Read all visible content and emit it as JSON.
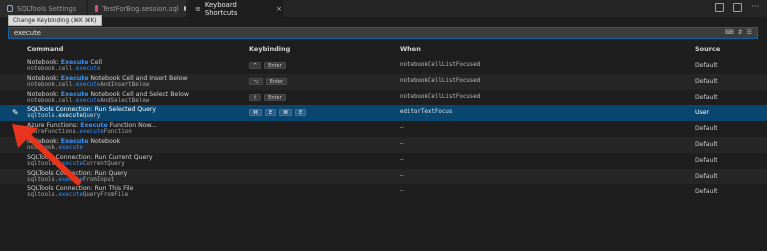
{
  "tabs": [
    {
      "label": "SQLTools Settings",
      "active": false
    },
    {
      "label": "TestForBog.session.sql",
      "active": false,
      "modified": true
    },
    {
      "label": "Keyboard Shortcuts",
      "active": true,
      "close": "×"
    }
  ],
  "tooltip": "Change Keybinding (⌘K ⌘K)",
  "search": {
    "value": "execute",
    "icons": [
      "⌨",
      "⇵",
      "☰"
    ]
  },
  "headers": {
    "command": "Command",
    "keybinding": "Keybinding",
    "when": "When",
    "source": "Source"
  },
  "rows": [
    {
      "title_pre": "Notebook: ",
      "title_hl": "Execute",
      "title_post": " Cell",
      "id_pre": "notebook.cell.",
      "id_hl": "execute",
      "id_post": "",
      "keys": [
        "^",
        "Enter"
      ],
      "when": "notebookCellListFocused",
      "source": "Default"
    },
    {
      "title_pre": "Notebook: ",
      "title_hl": "Execute",
      "title_post": " Notebook Cell and Insert Below",
      "id_pre": "notebook.cell.",
      "id_hl": "execute",
      "id_post": "AndInsertBelow",
      "keys": [
        "⌥",
        "Enter"
      ],
      "when": "notebookCellListFocused",
      "source": "Default"
    },
    {
      "title_pre": "Notebook: ",
      "title_hl": "Execute",
      "title_post": " Notebook Cell and Select Below",
      "id_pre": "notebook.cell.",
      "id_hl": "execute",
      "id_post": "AndSelectBelow",
      "keys": [
        "⇧",
        "Enter"
      ],
      "when": "notebookCellListFocused",
      "source": "Default"
    },
    {
      "title_pre": "SQLTools Connection: Run Selected Query",
      "title_hl": "",
      "title_post": "",
      "id_pre": "sqltools.",
      "id_hl": "execute",
      "id_post": "Query",
      "keys": [
        "⌘",
        "E",
        "⌘",
        "E"
      ],
      "when": "editorTextFocus",
      "source": "User",
      "selected": true
    },
    {
      "title_pre": "Azure Functions: ",
      "title_hl": "Execute",
      "title_post": " Function Now...",
      "id_pre": "azureFunctions.",
      "id_hl": "execute",
      "id_post": "Function",
      "keys": [],
      "when": "—",
      "source": "Default"
    },
    {
      "title_pre": "Notebook: ",
      "title_hl": "Execute",
      "title_post": " Notebook",
      "id_pre": "notebook.",
      "id_hl": "execute",
      "id_post": "",
      "keys": [],
      "when": "—",
      "source": "Default"
    },
    {
      "title_pre": "SQLTools Connection: Run Current Query",
      "title_hl": "",
      "title_post": "",
      "id_pre": "sqltools.",
      "id_hl": "execute",
      "id_post": "CurrentQuery",
      "keys": [],
      "when": "—",
      "source": "Default"
    },
    {
      "title_pre": "SQLTools Connection: Run Query",
      "title_hl": "",
      "title_post": "",
      "id_pre": "sqltools.",
      "id_hl": "execute",
      "id_post": "FromInput",
      "keys": [],
      "when": "—",
      "source": "Default"
    },
    {
      "title_pre": "SQLTools Connection: Run This File",
      "title_hl": "",
      "title_post": "",
      "id_pre": "sqltools.",
      "id_hl": "execute",
      "id_post": "QueryFromFile",
      "keys": [],
      "when": "—",
      "source": "Default"
    }
  ],
  "colors": {
    "accent": "#3794ff",
    "selected_row": "#094771",
    "arrow": "#e8341c"
  }
}
